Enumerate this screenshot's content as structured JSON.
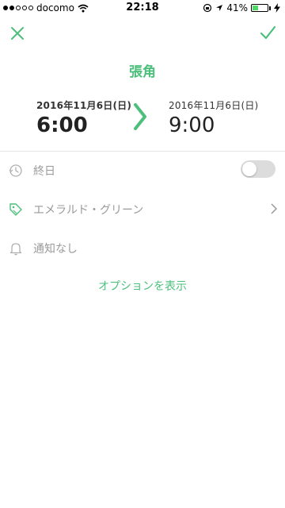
{
  "status_bar": {
    "carrier": "docomo",
    "time": "22:18",
    "battery": "41%",
    "battery_level": 0.41
  },
  "header": {
    "title": "張角"
  },
  "schedule": {
    "start_date": "2016年11月6日(日)",
    "start_time": "6:00",
    "end_date": "2016年11月6日(日)",
    "end_time": "9:00"
  },
  "options": {
    "all_day_label": "終日",
    "all_day_on": false,
    "color_label": "エメラルド・グリーン",
    "notification_label": "通知なし"
  },
  "show_options_label": "オプションを表示",
  "colors": {
    "accent": "#4cbf7b"
  }
}
